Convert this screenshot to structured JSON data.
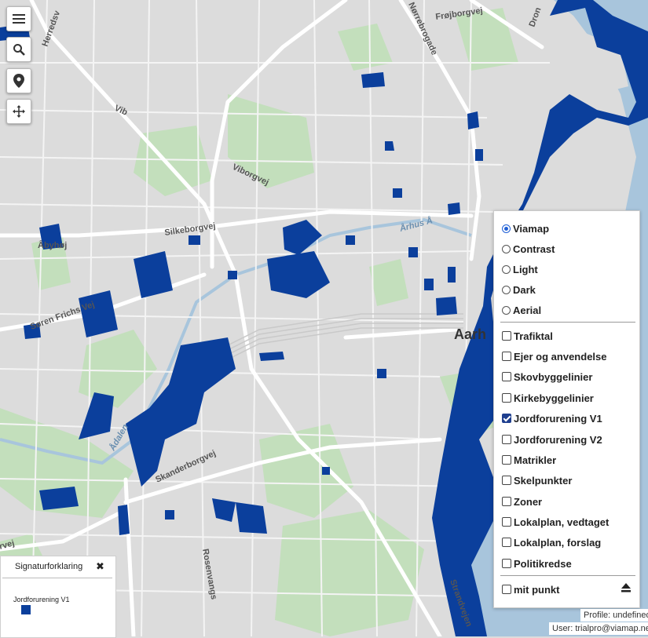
{
  "map": {
    "street_labels": [
      {
        "text": "Herredsv",
        "name": "label-herredsvej"
      },
      {
        "text": "Nørrebrogade",
        "name": "label-norrebrogade"
      },
      {
        "text": "Frøjborgvej",
        "name": "label-frojborgvej"
      },
      {
        "text": "Dron",
        "name": "label-dron"
      },
      {
        "text": "Vib",
        "name": "label-vib"
      },
      {
        "text": "Viborgvej",
        "name": "label-viborgvej"
      },
      {
        "text": "Silkeborgvej",
        "name": "label-silkeborgvej"
      },
      {
        "text": "Åbyhøj",
        "name": "label-abyhoj"
      },
      {
        "text": "Søren Frichs Vej",
        "name": "label-soren-frichs-vej"
      },
      {
        "text": "Århus Å",
        "name": "label-arhus-a"
      },
      {
        "text": "Aarh",
        "name": "label-aarhus"
      },
      {
        "text": "Ådalen",
        "name": "label-adalen"
      },
      {
        "text": "Skanderborgvej",
        "name": "label-skanderborgvej"
      },
      {
        "text": "Rosenvangs",
        "name": "label-rosenvangs"
      },
      {
        "text": "Strandvejen",
        "name": "label-strandvejen"
      },
      {
        "text": "rvej",
        "name": "label-rvej"
      }
    ],
    "colors": {
      "land": "#dcdcdc",
      "park": "#c3dfbc",
      "water": "#a8c5dc",
      "road": "#ffffff",
      "overlay": "#0b3f9c"
    }
  },
  "controls": {
    "menu": "menu-icon",
    "search": "search-icon",
    "location": "location-pin-icon",
    "pan": "crosshair-icon"
  },
  "layers": {
    "basemaps": [
      {
        "label": "Viamap",
        "selected": true
      },
      {
        "label": "Contrast",
        "selected": false
      },
      {
        "label": "Light",
        "selected": false
      },
      {
        "label": "Dark",
        "selected": false
      },
      {
        "label": "Aerial",
        "selected": false
      }
    ],
    "overlays": [
      {
        "label": "Trafiktal",
        "checked": false
      },
      {
        "label": "Ejer og anvendelse",
        "checked": false
      },
      {
        "label": "Skovbyggelinier",
        "checked": false
      },
      {
        "label": "Kirkebyggelinier",
        "checked": false
      },
      {
        "label": "Jordforurening V1",
        "checked": true
      },
      {
        "label": "Jordforurening V2",
        "checked": false
      },
      {
        "label": "Matrikler",
        "checked": false
      },
      {
        "label": "Skelpunkter",
        "checked": false
      },
      {
        "label": "Zoner",
        "checked": false
      },
      {
        "label": "Lokalplan, vedtaget",
        "checked": false
      },
      {
        "label": "Lokalplan, forslag",
        "checked": false
      },
      {
        "label": "Politikredse",
        "checked": false
      }
    ],
    "my_point": {
      "label": "mit punkt",
      "checked": false
    }
  },
  "legend": {
    "title": "Signaturforklaring",
    "close": "✖",
    "item": "Jordforurening V1"
  },
  "status": {
    "profile": "Profile: undefined",
    "user": "User: trialpro@viamap.net"
  }
}
